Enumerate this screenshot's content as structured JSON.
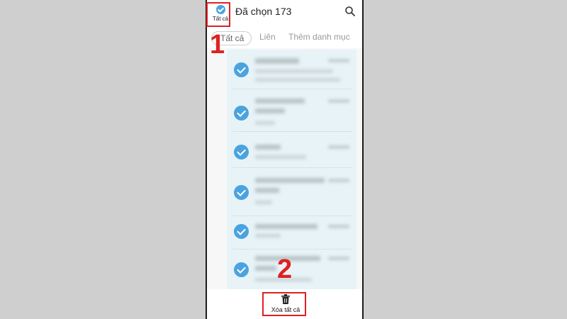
{
  "header": {
    "select_all_label": "Tất cả",
    "title": "Đã chọn 173"
  },
  "tabs": [
    {
      "label": "Tất cả",
      "active": true
    },
    {
      "label": "Liên"
    },
    {
      "label": "Thêm danh mục"
    }
  ],
  "bottom": {
    "delete_all_label": "Xóa tất cả"
  },
  "annotations": {
    "step1": "1",
    "step2": "2"
  },
  "colors": {
    "accent": "#4aa3df",
    "highlight": "#e02020",
    "selected_bg": "#e7f3f7"
  },
  "icons": [
    "check-circle-icon",
    "search-icon",
    "trash-icon"
  ]
}
